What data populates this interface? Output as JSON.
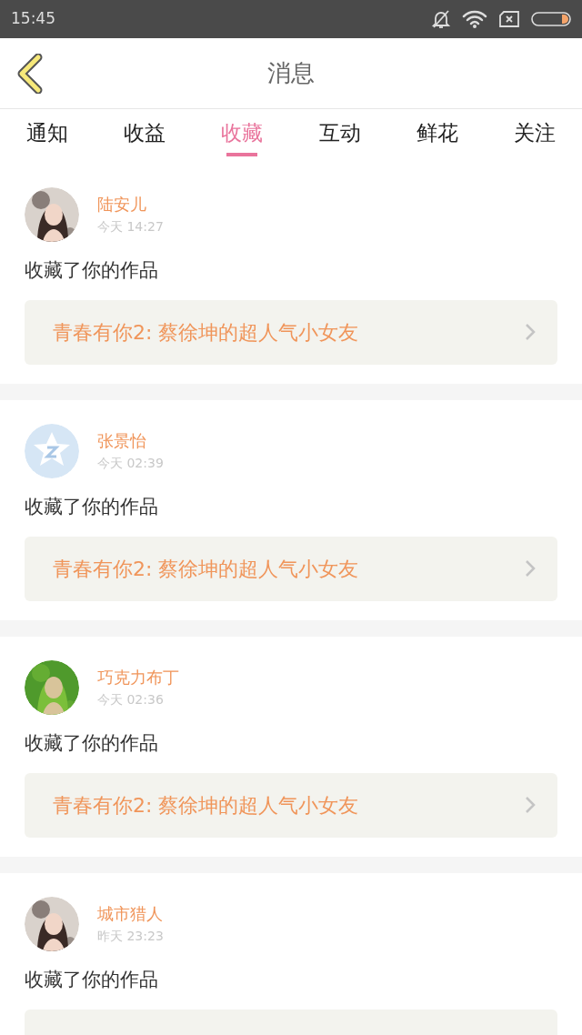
{
  "status_bar": {
    "time": "15:45"
  },
  "header": {
    "title": "消息"
  },
  "tabs": [
    {
      "label": "通知",
      "selected": false
    },
    {
      "label": "收益",
      "selected": false
    },
    {
      "label": "收藏",
      "selected": true
    },
    {
      "label": "互动",
      "selected": false
    },
    {
      "label": "鲜花",
      "selected": false
    },
    {
      "label": "关注",
      "selected": false
    }
  ],
  "messages": [
    {
      "name": "陆安儿",
      "time": "今天 14:27",
      "action": "收藏了你的作品",
      "work": "青春有你2: 蔡徐坤的超人气小女友"
    },
    {
      "avatar": {
        "kind": "default"
      },
      "name": "张景怡",
      "time": "今天 02:39",
      "action": "收藏了你的作品",
      "work": "青春有你2: 蔡徐坤的超人气小女友"
    },
    {
      "name": "巧克力布丁",
      "time": "今天 02:36",
      "action": "收藏了你的作品",
      "work": "青春有你2: 蔡徐坤的超人气小女友"
    },
    {
      "name": "城市猎人",
      "time": "昨天 23:23",
      "action": "收藏了你的作品"
    }
  ]
}
